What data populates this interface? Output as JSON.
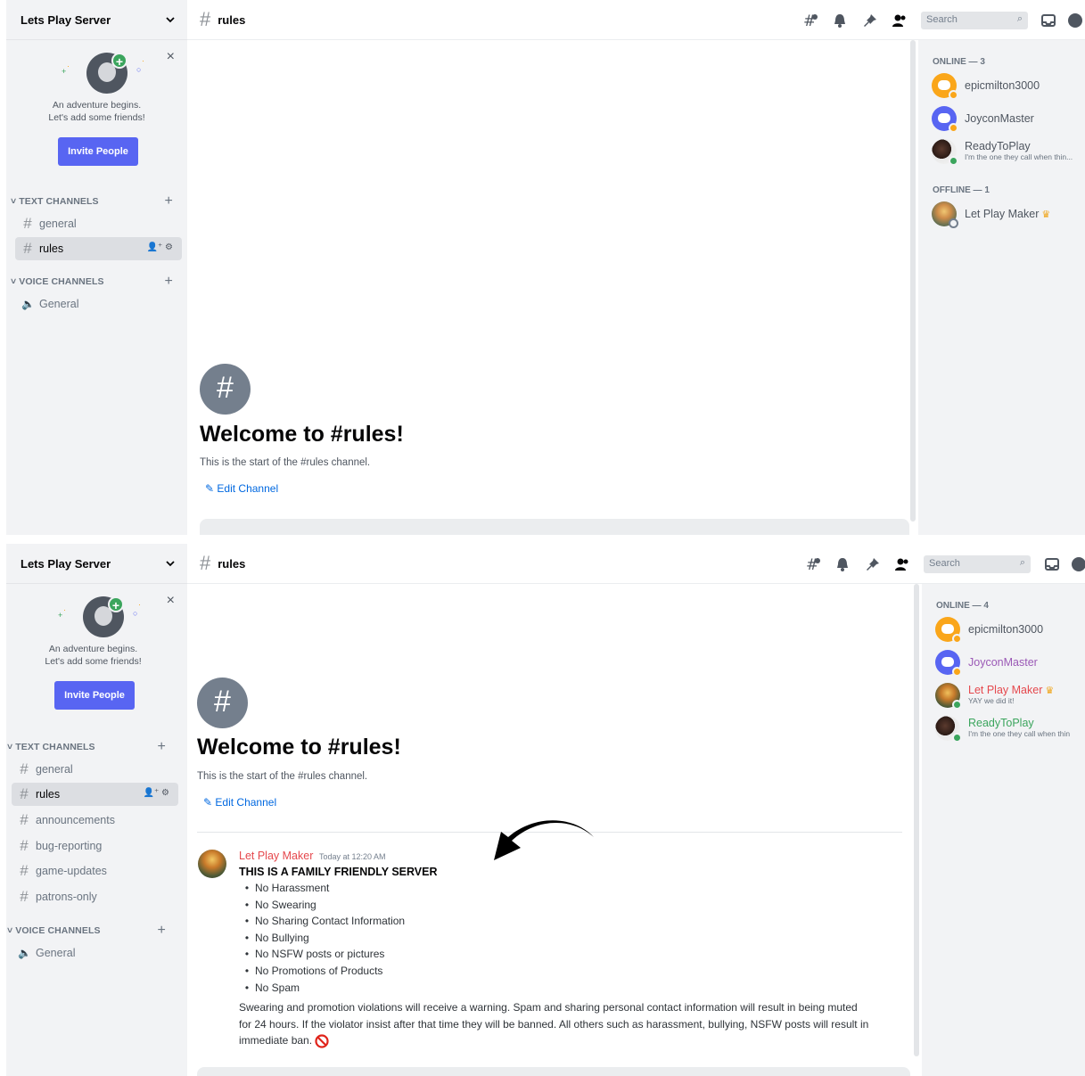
{
  "server": {
    "name": "Lets Play Server"
  },
  "invite": {
    "line1": "An adventure begins.",
    "line2": "Let's add some friends!",
    "button": "Invite People",
    "close": "×"
  },
  "categories": {
    "text": "TEXT CHANNELS",
    "voice": "VOICE CHANNELS"
  },
  "channel": {
    "name": "rules",
    "welcome_title": "Welcome to #rules!",
    "welcome_sub": "This is the start of the #rules channel.",
    "edit_label": "Edit Channel"
  },
  "search": {
    "placeholder": "Search"
  },
  "panel1": {
    "text_channels": [
      "general",
      "rules"
    ],
    "voice_channels": [
      "General"
    ],
    "members_online_label": "ONLINE — 3",
    "members_offline_label": "OFFLINE — 1",
    "online": [
      {
        "name": "epicmilton3000",
        "status": ""
      },
      {
        "name": "JoyconMaster",
        "status": ""
      },
      {
        "name": "ReadyToPlay",
        "status": "I'm the one they call when thin..."
      }
    ],
    "offline": [
      {
        "name": "Let Play Maker",
        "status": ""
      }
    ]
  },
  "panel2": {
    "text_channels": [
      "general",
      "rules",
      "announcements",
      "bug-reporting",
      "game-updates",
      "patrons-only"
    ],
    "voice_channels": [
      "General"
    ],
    "members_online_label": "ONLINE — 4",
    "online": [
      {
        "name": "epicmilton3000",
        "status": ""
      },
      {
        "name": "JoyconMaster",
        "status": ""
      },
      {
        "name": "Let Play Maker",
        "status": "YAY we did it!"
      },
      {
        "name": "ReadyToPlay",
        "status": "I'm the one they call when thin"
      }
    ]
  },
  "message": {
    "author": "Let Play Maker",
    "timestamp": "Today at 12:20 AM",
    "heading": "THIS IS A FAMILY FRIENDLY SERVER",
    "rules": [
      "No Harassment",
      "No Swearing",
      "No Sharing Contact Information",
      "No Bullying",
      "No NSFW posts or pictures",
      "No Promotions of Products",
      "No Spam"
    ],
    "body": "Swearing and promotion violations will receive a warning. Spam and sharing personal contact information will result in being muted for 24 hours. If the violator insist after that time they will be banned. All others such as harassment, bullying, NSFW posts will result in immediate ban."
  },
  "colors": {
    "brand": "#5865f2",
    "online": "#3ba55d",
    "idle": "#faa61a",
    "owner_name": "#e5484d",
    "link": "#0068e0"
  }
}
